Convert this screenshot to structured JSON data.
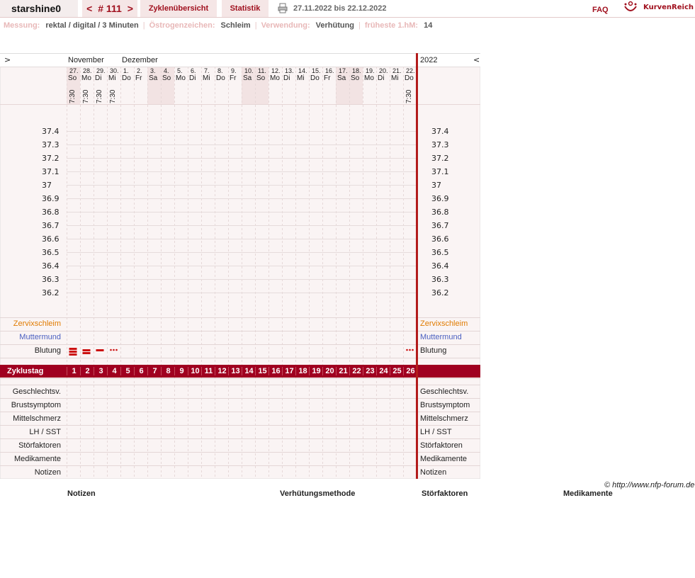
{
  "header": {
    "user": "starshine0",
    "nav": {
      "prev": "<",
      "cycle": "# 111",
      "next": ">"
    },
    "tabs": [
      "Zyklenübersicht",
      "Statistik"
    ],
    "date_range": "27.11.2022 bis 22.12.2022",
    "faq": "FAQ",
    "brand": "KurvenReich"
  },
  "meta": [
    {
      "label": "Messung:",
      "value": "rektal / digital / 3 Minuten"
    },
    {
      "label": "Östrogenzeichen:",
      "value": "Schleim"
    },
    {
      "label": "Verwendung:",
      "value": "Verhütung"
    },
    {
      "label": "früheste 1.hM:",
      "value": "14"
    }
  ],
  "chart": {
    "left_arrow": ">",
    "right_arrow": "<",
    "year": "2022",
    "months": [
      {
        "name": "November",
        "day_index": 0
      },
      {
        "name": "Dezember",
        "day_index": 4
      }
    ],
    "days": [
      {
        "date": "27.",
        "wd": "So",
        "time": "7:30",
        "weekend": true
      },
      {
        "date": "28.",
        "wd": "Mo",
        "time": "7:30",
        "weekend": false
      },
      {
        "date": "29.",
        "wd": "Di",
        "time": "7:30",
        "weekend": false
      },
      {
        "date": "30.",
        "wd": "Mi",
        "time": "7:30",
        "weekend": false
      },
      {
        "date": "1.",
        "wd": "Do",
        "time": "",
        "weekend": false
      },
      {
        "date": "2.",
        "wd": "Fr",
        "time": "",
        "weekend": false
      },
      {
        "date": "3.",
        "wd": "Sa",
        "time": "",
        "weekend": true
      },
      {
        "date": "4.",
        "wd": "So",
        "time": "",
        "weekend": true
      },
      {
        "date": "5.",
        "wd": "Mo",
        "time": "",
        "weekend": false
      },
      {
        "date": "6.",
        "wd": "Di",
        "time": "",
        "weekend": false
      },
      {
        "date": "7.",
        "wd": "Mi",
        "time": "",
        "weekend": false
      },
      {
        "date": "8.",
        "wd": "Do",
        "time": "",
        "weekend": false
      },
      {
        "date": "9.",
        "wd": "Fr",
        "time": "",
        "weekend": false
      },
      {
        "date": "10.",
        "wd": "Sa",
        "time": "",
        "weekend": true
      },
      {
        "date": "11.",
        "wd": "So",
        "time": "",
        "weekend": true
      },
      {
        "date": "12.",
        "wd": "Mo",
        "time": "",
        "weekend": false
      },
      {
        "date": "13.",
        "wd": "Di",
        "time": "",
        "weekend": false
      },
      {
        "date": "14.",
        "wd": "Mi",
        "time": "",
        "weekend": false
      },
      {
        "date": "15.",
        "wd": "Do",
        "time": "",
        "weekend": false
      },
      {
        "date": "16.",
        "wd": "Fr",
        "time": "",
        "weekend": false
      },
      {
        "date": "17.",
        "wd": "Sa",
        "time": "",
        "weekend": true
      },
      {
        "date": "18.",
        "wd": "So",
        "time": "",
        "weekend": true
      },
      {
        "date": "19.",
        "wd": "Mo",
        "time": "",
        "weekend": false
      },
      {
        "date": "20.",
        "wd": "Di",
        "time": "",
        "weekend": false
      },
      {
        "date": "21.",
        "wd": "Mi",
        "time": "",
        "weekend": false
      },
      {
        "date": "22.",
        "wd": "Do",
        "time": "7:30",
        "weekend": false
      }
    ],
    "temp_ticks": [
      "37.4",
      "37.3",
      "37.2",
      "37.1",
      "37",
      "36.9",
      "36.8",
      "36.7",
      "36.6",
      "36.5",
      "36.4",
      "36.3",
      "36.2"
    ],
    "rows_top": [
      {
        "label": "Zervixschleim",
        "color": "#e07b00"
      },
      {
        "label": "Muttermund",
        "color": "#4a5fc0"
      },
      {
        "label": "Blutung",
        "color": "#222222"
      }
    ],
    "bleeding": [
      {
        "day_index": 0,
        "level": "heavy"
      },
      {
        "day_index": 1,
        "level": "medium"
      },
      {
        "day_index": 2,
        "level": "light"
      },
      {
        "day_index": 3,
        "level": "spotting"
      },
      {
        "day_index": 25,
        "level": "spotting"
      }
    ],
    "cycle_label": "Zyklustag",
    "cycle_days": [
      "1",
      "2",
      "3",
      "4",
      "5",
      "6",
      "7",
      "8",
      "9",
      "10",
      "11",
      "12",
      "13",
      "14",
      "15",
      "16",
      "17",
      "18",
      "19",
      "20",
      "21",
      "22",
      "23",
      "24",
      "25",
      "26"
    ],
    "rows_bottom": [
      "Geschlechtsv.",
      "Brustsymptom",
      "Mittelschmerz",
      "LH / SST",
      "Störfaktoren",
      "Medikamente",
      "Notizen"
    ]
  },
  "footer": {
    "copyright": "© http://www.nfp-forum.de",
    "sections": [
      "Notizen",
      "Verhütungsmethode",
      "Störfaktoren",
      "Medikamente"
    ]
  },
  "colors": {
    "accent": "#a0101e",
    "cycle_bar": "#a00020",
    "weekend": "#f2e3e3",
    "grid_bg": "#faf4f4"
  }
}
